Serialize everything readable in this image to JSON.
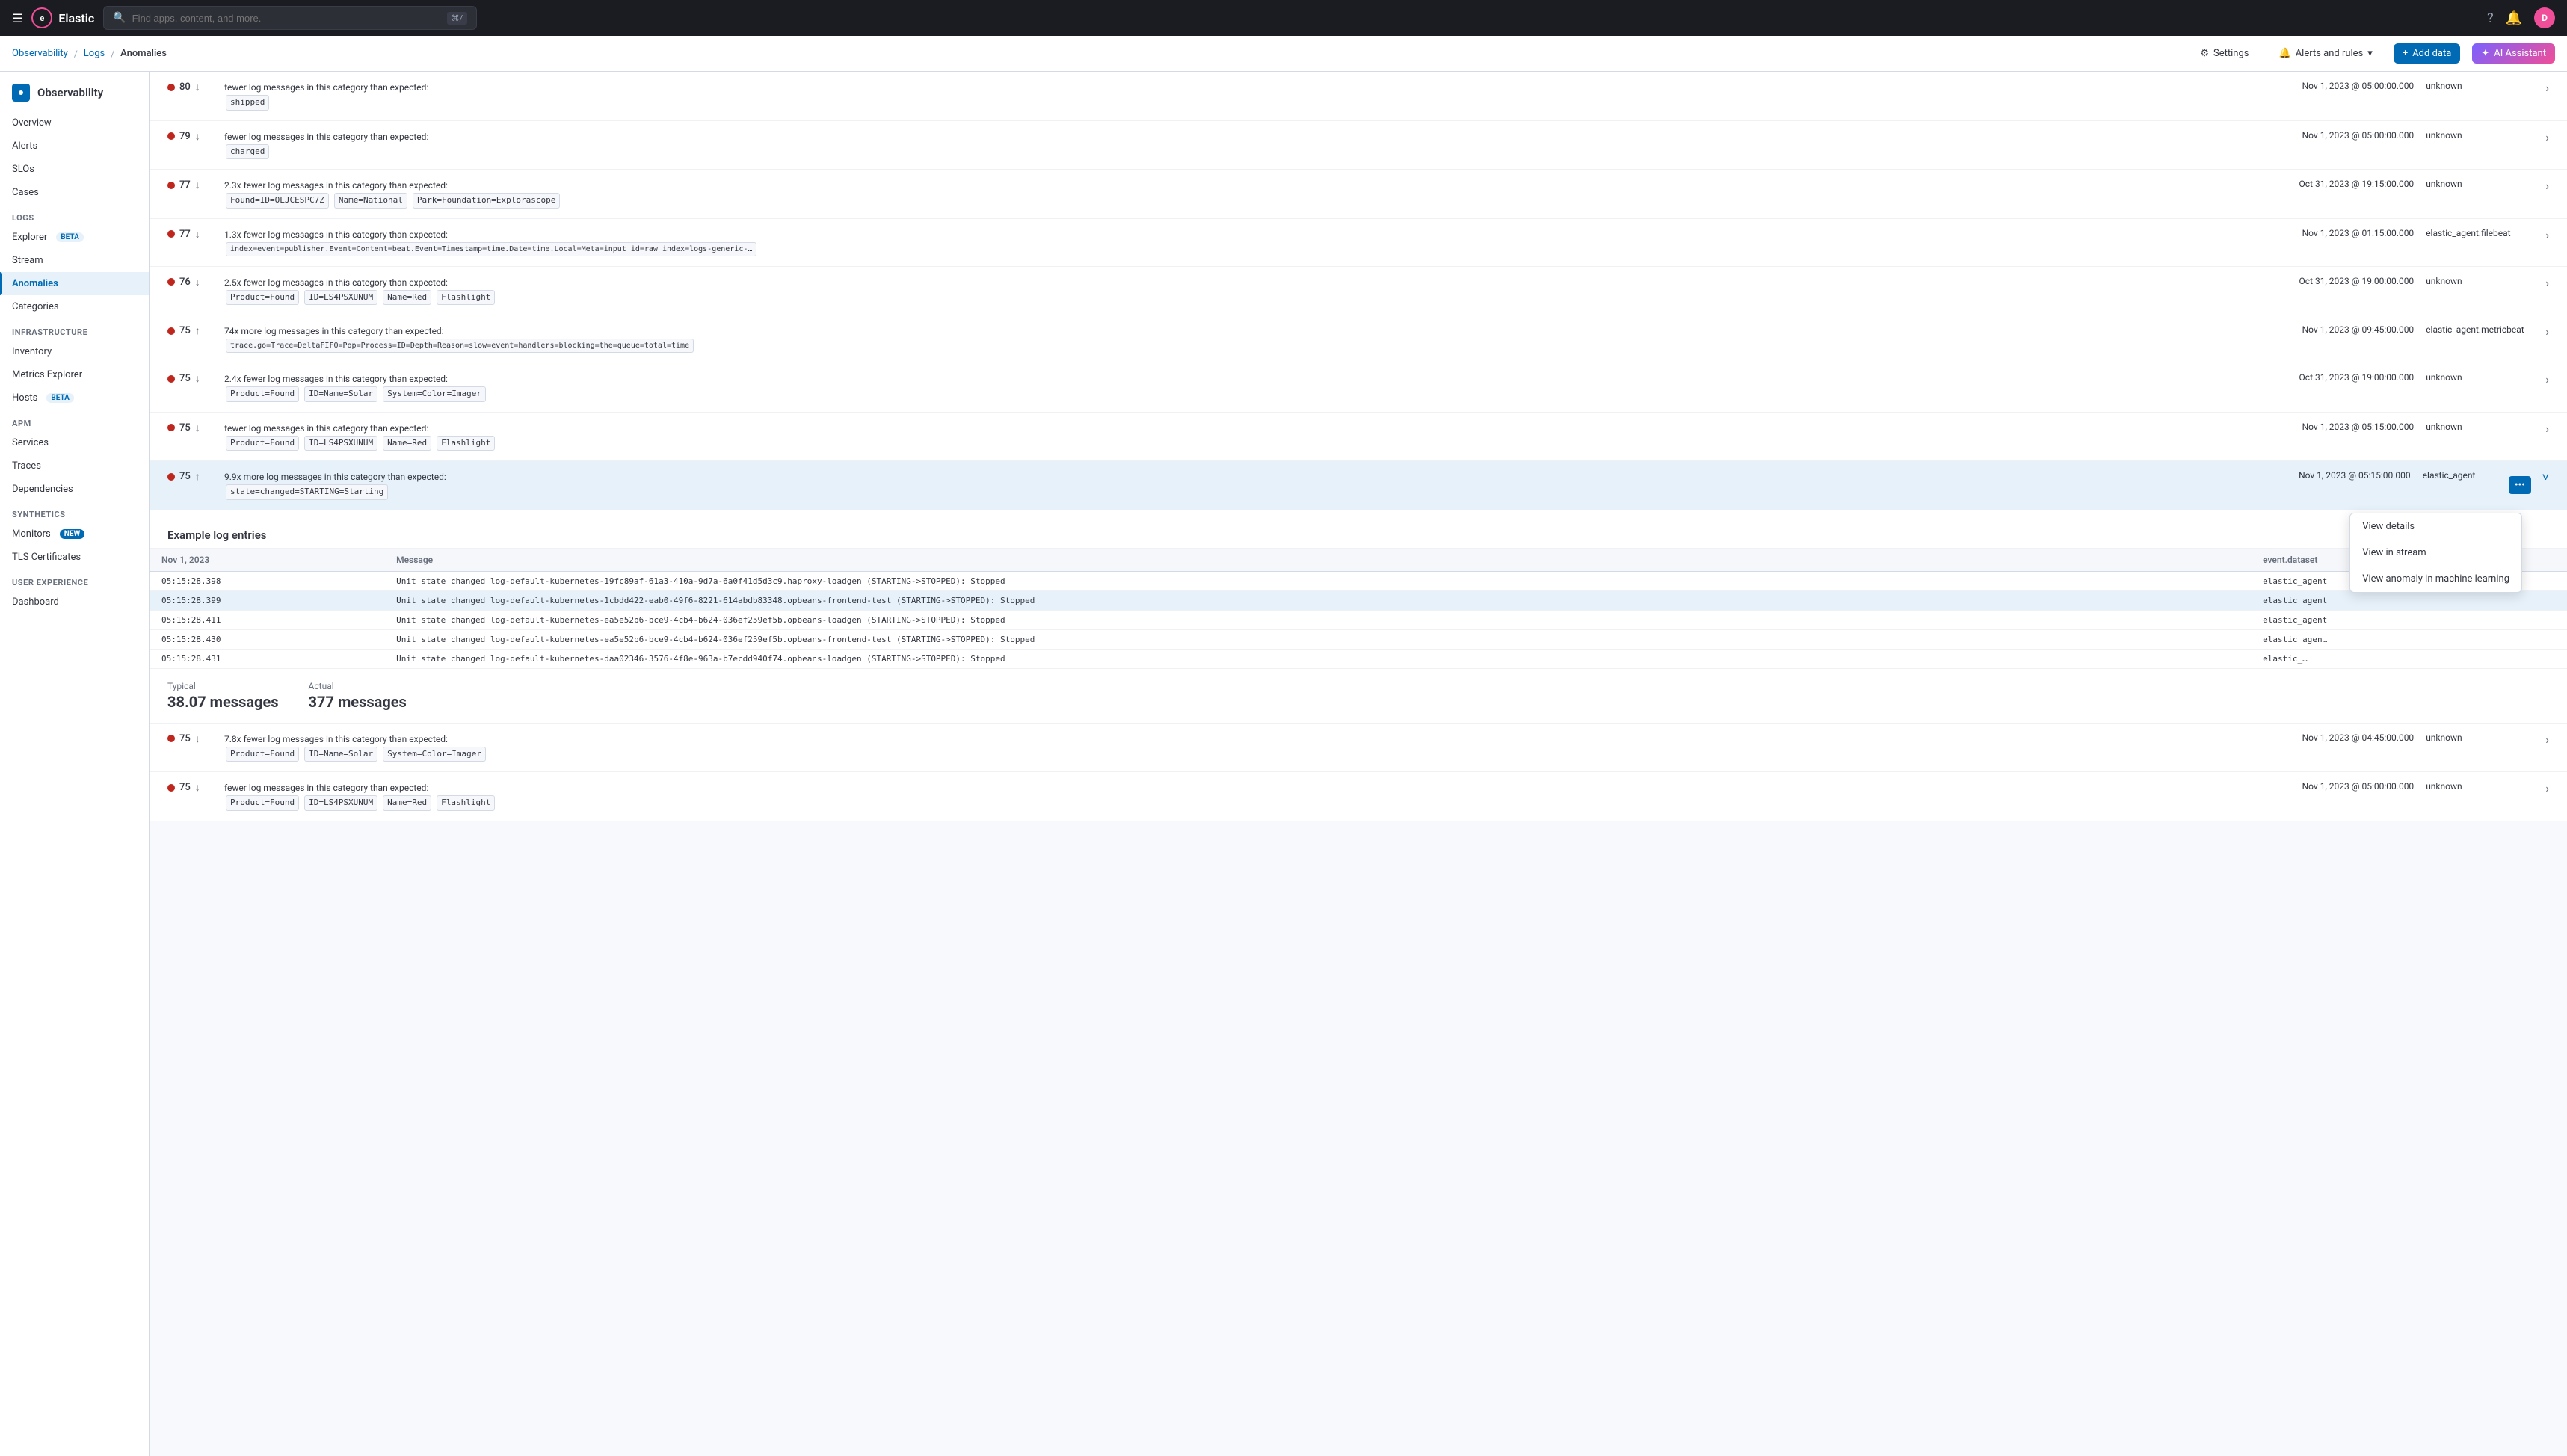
{
  "app": {
    "name": "Elastic",
    "logo_letter": "e"
  },
  "topbar": {
    "search_placeholder": "Find apps, content, and more.",
    "kbd": "⌘/",
    "avatar_letter": "D"
  },
  "navbar": {
    "breadcrumbs": [
      "Observability",
      "Logs",
      "Anomalies"
    ],
    "settings_label": "Settings",
    "alerts_label": "Alerts and rules",
    "add_data_label": "Add data",
    "ai_label": "AI Assistant"
  },
  "sidebar": {
    "section_title": "Observability",
    "overview": "Overview",
    "alerts": "Alerts",
    "slos": "SLOs",
    "cases": "Cases",
    "logs_section": "Logs",
    "explorer": "Explorer",
    "explorer_badge": "BETA",
    "stream": "Stream",
    "anomalies": "Anomalies",
    "categories": "Categories",
    "infrastructure_section": "Infrastructure",
    "inventory": "Inventory",
    "metrics_explorer": "Metrics Explorer",
    "hosts": "Hosts",
    "hosts_badge": "BETA",
    "apm_section": "APM",
    "services": "Services",
    "traces": "Traces",
    "dependencies": "Dependencies",
    "synthetics_section": "Synthetics",
    "monitors": "Monitors",
    "monitors_badge": "NEW",
    "tls_certificates": "TLS Certificates",
    "user_experience_section": "User Experience",
    "dashboard": "Dashboard"
  },
  "anomalies": [
    {
      "score": 80,
      "direction": "down",
      "message": "fewer log messages in this category than expected:",
      "tags": [
        "shipped"
      ],
      "time": "Nov 1, 2023 @ 05:00:00.000",
      "source": "unknown",
      "expanded": false
    },
    {
      "score": 79,
      "direction": "down",
      "message": "fewer log messages in this category than expected:",
      "tags": [
        "charged"
      ],
      "time": "Nov 1, 2023 @ 05:00:00.000",
      "source": "unknown",
      "expanded": false
    },
    {
      "score": 77,
      "direction": "down",
      "message": "2.3x fewer log messages in this category than expected:",
      "tags": [
        "Found=ID=OLJCESPC7Z",
        "Name=National",
        "Park=Foundation=Explorascope"
      ],
      "time": "Oct 31, 2023 @ 19:15:00.000",
      "source": "unknown",
      "expanded": false
    },
    {
      "score": 77,
      "direction": "down",
      "message": "1.3x fewer log messages in this category than expected:",
      "tags": [
        "index=event=publisher.Event=Content=beat.Event=Timestamp=time.Date=time.Local=Meta=input_id=raw_index=logs-generic-…"
      ],
      "time": "Nov 1, 2023 @ 01:15:00.000",
      "source": "elastic_agent.filebeat",
      "expanded": false
    },
    {
      "score": 76,
      "direction": "down",
      "message": "2.5x fewer log messages in this category than expected:",
      "tags": [
        "Product=Found",
        "ID=LS4PSXUNUM",
        "Name=Red",
        "Flashlight"
      ],
      "time": "Oct 31, 2023 @ 19:00:00.000",
      "source": "unknown",
      "expanded": false
    },
    {
      "score": 75,
      "direction": "up",
      "message": "74x more log messages in this category than expected:",
      "tags": [
        "trace.go=Trace=DeltaFIFO=Pop=Process=ID=Depth=Reason=slow=event=handlers=blocking=the=queue=total=time"
      ],
      "time": "Nov 1, 2023 @ 09:45:00.000",
      "source": "elastic_agent.metricbeat",
      "expanded": false
    },
    {
      "score": 75,
      "direction": "down",
      "message": "2.4x fewer log messages in this category than expected:",
      "tags": [
        "Product=Found",
        "ID=Name=Solar",
        "System=Color=Imager"
      ],
      "time": "Oct 31, 2023 @ 19:00:00.000",
      "source": "unknown",
      "expanded": false
    },
    {
      "score": 75,
      "direction": "down",
      "message": "fewer log messages in this category than expected:",
      "tags": [
        "Product=Found",
        "ID=LS4PSXUNUM",
        "Name=Red",
        "Flashlight"
      ],
      "time": "Nov 1, 2023 @ 05:15:00.000",
      "source": "unknown",
      "expanded": false
    },
    {
      "score": 75,
      "direction": "up",
      "message": "9.9x more log messages in this category than expected:",
      "tags": [
        "state=changed=STARTING=Starting"
      ],
      "time": "Nov 1, 2023 @ 05:15:00.000",
      "source": "elastic_agent",
      "expanded": true,
      "highlighted": true
    }
  ],
  "example_logs": {
    "title": "Example log entries",
    "columns": [
      "Nov 1, 2023",
      "Message",
      "event.dataset"
    ],
    "rows": [
      {
        "time": "05:15:28.398",
        "message": "Unit state changed log-default-kubernetes-19fc89af-61a3-410a-9d7a-6a0f41d5d3c9.haproxy-loadgen (STARTING->STOPPED): Stopped",
        "dataset": "elastic_agent",
        "highlighted": false
      },
      {
        "time": "05:15:28.399",
        "message": "Unit state changed log-default-kubernetes-1cbdd422-eab0-49f6-8221-614abdb83348.opbeans-frontend-test (STARTING->STOPPED): Stopped",
        "dataset": "elastic_agent",
        "highlighted": true
      },
      {
        "time": "05:15:28.411",
        "message": "Unit state changed log-default-kubernetes-ea5e52b6-bce9-4cb4-b624-036ef259ef5b.opbeans-loadgen (STARTING->STOPPED): Stopped",
        "dataset": "elastic_agent",
        "highlighted": false
      },
      {
        "time": "05:15:28.430",
        "message": "Unit state changed log-default-kubernetes-ea5e52b6-bce9-4cb4-b624-036ef259ef5b.opbeans-frontend-test (STARTING->STOPPED): Stopped",
        "dataset": "elastic_agen…",
        "highlighted": false
      },
      {
        "time": "05:15:28.431",
        "message": "Unit state changed log-default-kubernetes-daa02346-3576-4f8e-963a-b7ecdd940f74.opbeans-loadgen (STARTING->STOPPED): Stopped",
        "dataset": "elastic_…",
        "highlighted": false
      }
    ]
  },
  "stats": {
    "typical_label": "Typical",
    "typical_value": "38.07 messages",
    "actual_label": "Actual",
    "actual_value": "377 messages"
  },
  "more_anomalies": [
    {
      "score": 75,
      "direction": "down",
      "message": "7.8x fewer log messages in this category than expected:",
      "tags": [
        "Product=Found",
        "ID=Name=Solar",
        "System=Color=Imager"
      ],
      "time": "Nov 1, 2023 @ 04:45:00.000",
      "source": "unknown"
    },
    {
      "score": 75,
      "direction": "down",
      "message": "fewer log messages in this category than expected:",
      "tags": [
        "Product=Found",
        "ID=LS4PSXUNUM",
        "Name=Red",
        "Flashlight"
      ],
      "time": "Nov 1, 2023 @ 05:00:00.000",
      "source": "unknown"
    }
  ],
  "context_menu": {
    "items": [
      "View details",
      "View in stream",
      "View anomaly in machine learning"
    ]
  }
}
